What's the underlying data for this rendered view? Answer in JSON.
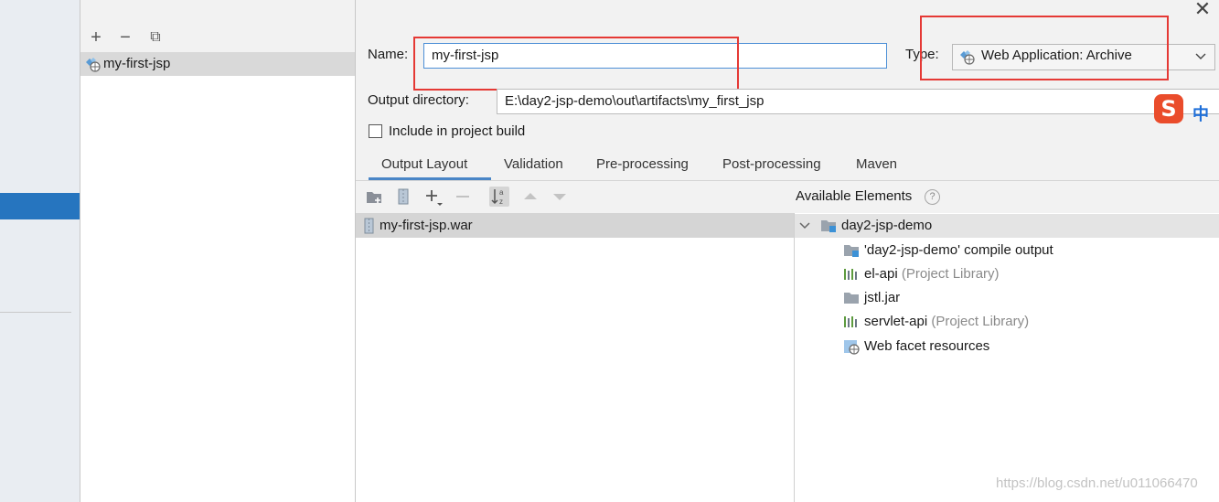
{
  "window": {
    "close_glyph": "✕"
  },
  "artifacts": {
    "toolbar": {
      "add_glyph": "+",
      "remove_glyph": "−",
      "copy_glyph": "⧉"
    },
    "items": [
      {
        "label": "my-first-jsp",
        "icon": "web-app-icon",
        "selected": true
      }
    ]
  },
  "form": {
    "name_label": "Name:",
    "name_value": "my-first-jsp",
    "type_label": "Type:",
    "type_value": "Web Application: Archive",
    "output_dir_label": "Output directory:",
    "output_dir_value": "E:\\day2-jsp-demo\\out\\artifacts\\my_first_jsp",
    "include_label": "Include in project build",
    "include_checked": false
  },
  "ime": {
    "logo": "S",
    "mode": "中"
  },
  "tabs": [
    {
      "label": "Output Layout",
      "active": true
    },
    {
      "label": "Validation"
    },
    {
      "label": "Pre-processing"
    },
    {
      "label": "Post-processing"
    },
    {
      "label": "Maven"
    }
  ],
  "output_layout": {
    "toolbar_icons": [
      "new-directory-icon",
      "archive-icon",
      "add-dropdown-icon",
      "remove-icon",
      "sort-alpha-icon",
      "move-up-icon",
      "move-down-icon"
    ],
    "root": {
      "label": "my-first-jsp.war",
      "icon": "war-archive-icon"
    }
  },
  "available": {
    "title": "Available Elements",
    "help_glyph": "?",
    "root": {
      "label": "day2-jsp-demo",
      "expanded": true
    },
    "children": [
      {
        "label": "'day2-jsp-demo' compile output",
        "suffix": "",
        "icon": "module-output-icon"
      },
      {
        "label": "el-api",
        "suffix": "(Project Library)",
        "icon": "library-icon"
      },
      {
        "label": "jstl.jar",
        "suffix": "",
        "icon": "folder-icon"
      },
      {
        "label": "servlet-api",
        "suffix": "(Project Library)",
        "icon": "library-icon"
      },
      {
        "label": "Web facet resources",
        "suffix": "",
        "icon": "web-resources-icon"
      }
    ]
  },
  "accent_colors": {
    "selection": "#2675bf",
    "annotation": "#e53935",
    "focus": "#4c8fd6"
  },
  "watermark": "https://blog.csdn.net/u011066470"
}
